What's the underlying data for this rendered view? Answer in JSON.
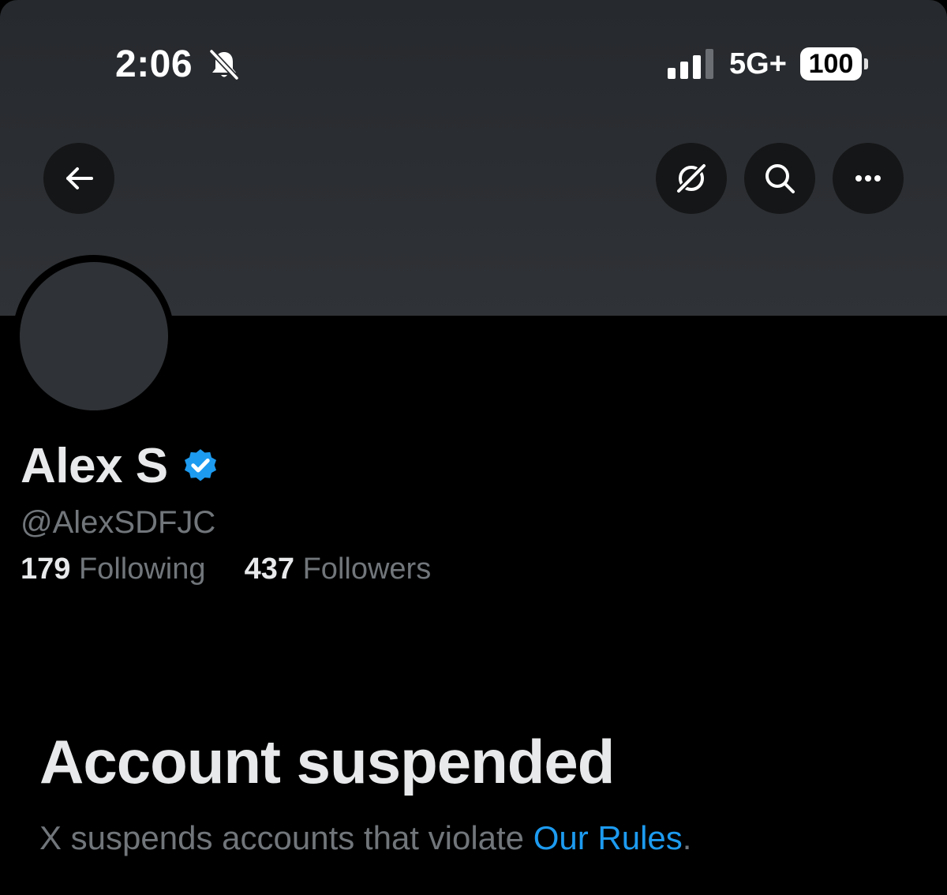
{
  "status_bar": {
    "time": "2:06",
    "network": "5G+",
    "battery": "100"
  },
  "nav": {
    "back_icon": "arrow-left-icon",
    "grok_icon": "grok-slash-icon",
    "search_icon": "search-icon",
    "more_icon": "more-horizontal-icon"
  },
  "profile": {
    "name": "Alex S",
    "handle": "@AlexSDFJC",
    "following_count": "179",
    "following_label": "Following",
    "followers_count": "437",
    "followers_label": "Followers"
  },
  "suspension": {
    "title": "Account suspended",
    "message": "X suspends accounts that violate ",
    "link": "Our Rules",
    "trailing": "."
  },
  "colors": {
    "background": "#000000",
    "banner": "#2f3236",
    "accent": "#1d9bf0",
    "secondary_text": "#71767b",
    "primary_text": "#e7e9ea"
  }
}
